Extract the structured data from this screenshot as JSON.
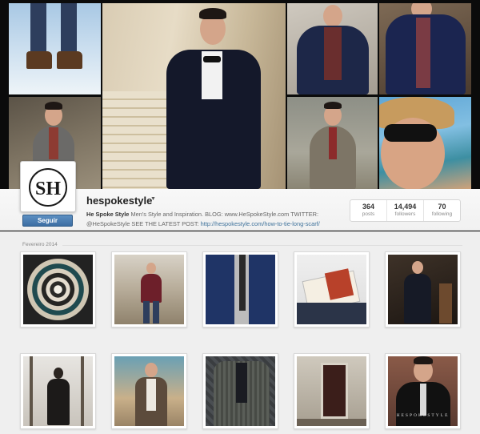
{
  "profile": {
    "username": "hespokestyle",
    "follow_label": "Seguir",
    "bio_name": "He Spoke Style",
    "bio_text": "Men's Style and Inspiration. BLOG: www.HeSpokeStyle.com TWITTER: @HeSpokeStyle SEE THE LATEST POST:",
    "bio_link": "http://hespokestyle.com/how-to-tie-long-scarf/",
    "avatar_monogram": "SH"
  },
  "stats": [
    {
      "value": "364",
      "label": "posts"
    },
    {
      "value": "14,494",
      "label": "followers"
    },
    {
      "value": "70",
      "label": "following"
    }
  ],
  "feed": {
    "date_label": "Fevereiro 2014",
    "watermark": "HESPOKESTYLE"
  },
  "colors": {
    "accent": "#3f729b",
    "button": "#3d6ea3",
    "background": "#efefef"
  }
}
